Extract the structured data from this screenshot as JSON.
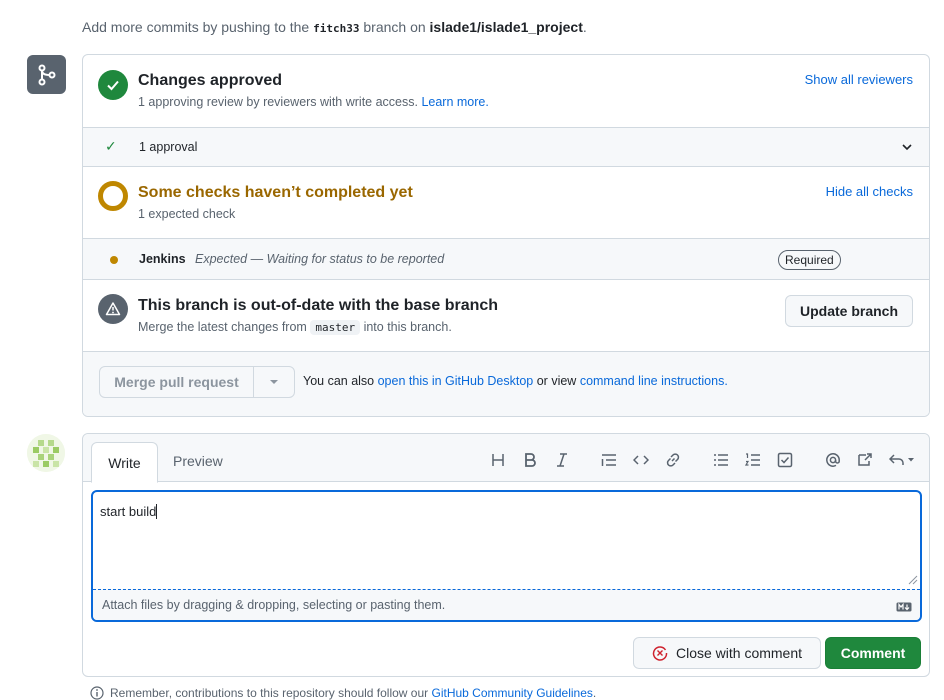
{
  "hint": {
    "prefix": "Add more commits by pushing to the",
    "branch": "fitch33",
    "middle": "branch on",
    "repo": "islade1/islade1_project",
    "suffix": "."
  },
  "approved": {
    "title": "Changes approved",
    "subtitle": "1 approving review by reviewers with write access.",
    "learn_more": "Learn more.",
    "show_reviewers": "Show all reviewers"
  },
  "approval_row": {
    "label": "1 approval"
  },
  "checks": {
    "title": "Some checks haven’t completed yet",
    "subtitle": "1 expected check",
    "hide_checks": "Hide all checks"
  },
  "jenkins": {
    "name": "Jenkins",
    "description": "Expected — Waiting for status to be reported",
    "badge": "Required"
  },
  "outdated": {
    "title": "This branch is out-of-date with the base branch",
    "sub_prefix": "Merge the latest changes from",
    "base_branch": "master",
    "sub_suffix": "into this branch.",
    "update_button": "Update branch"
  },
  "merge": {
    "button": "Merge pull request",
    "note_prefix": "You can also",
    "desktop_link": "open this in GitHub Desktop",
    "note_middle": "or view",
    "cli_link": "command line instructions",
    "note_suffix": "."
  },
  "comment": {
    "tab_write": "Write",
    "tab_preview": "Preview",
    "text": "start build",
    "attach": "Attach files by dragging & dropping, selecting or pasting them.",
    "close_button": "Close with comment",
    "comment_button": "Comment"
  },
  "footer": {
    "prefix": "Remember, contributions to this repository should follow our",
    "link": "GitHub Community Guidelines",
    "suffix": "."
  },
  "colors": {
    "success": "#1f883d",
    "attention": "#bf8700",
    "accent": "#0969da",
    "muted": "#59636e"
  }
}
